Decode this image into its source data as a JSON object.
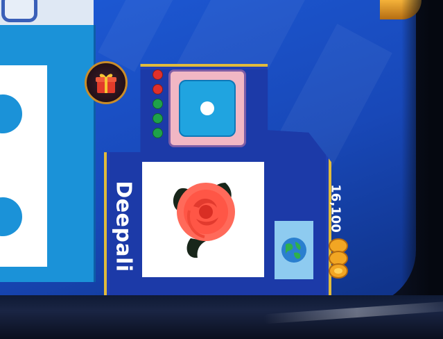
{
  "player": {
    "name": "Deepali",
    "coins": "16,100"
  },
  "indicators": [
    "red",
    "red",
    "green",
    "green",
    "green"
  ],
  "dice": {
    "value": 1
  },
  "colors": {
    "board": "#1d5ad6",
    "card": "#1f3fb5",
    "card_border": "#e1bb3c",
    "dice": "#20a4e0",
    "lamp_red": "#e0302b",
    "lamp_green": "#1ea24a"
  },
  "icons": {
    "gift": "gift-icon",
    "avatar": "rose-icon",
    "flag": "globe-icon",
    "coins": "coin-stack-icon"
  }
}
